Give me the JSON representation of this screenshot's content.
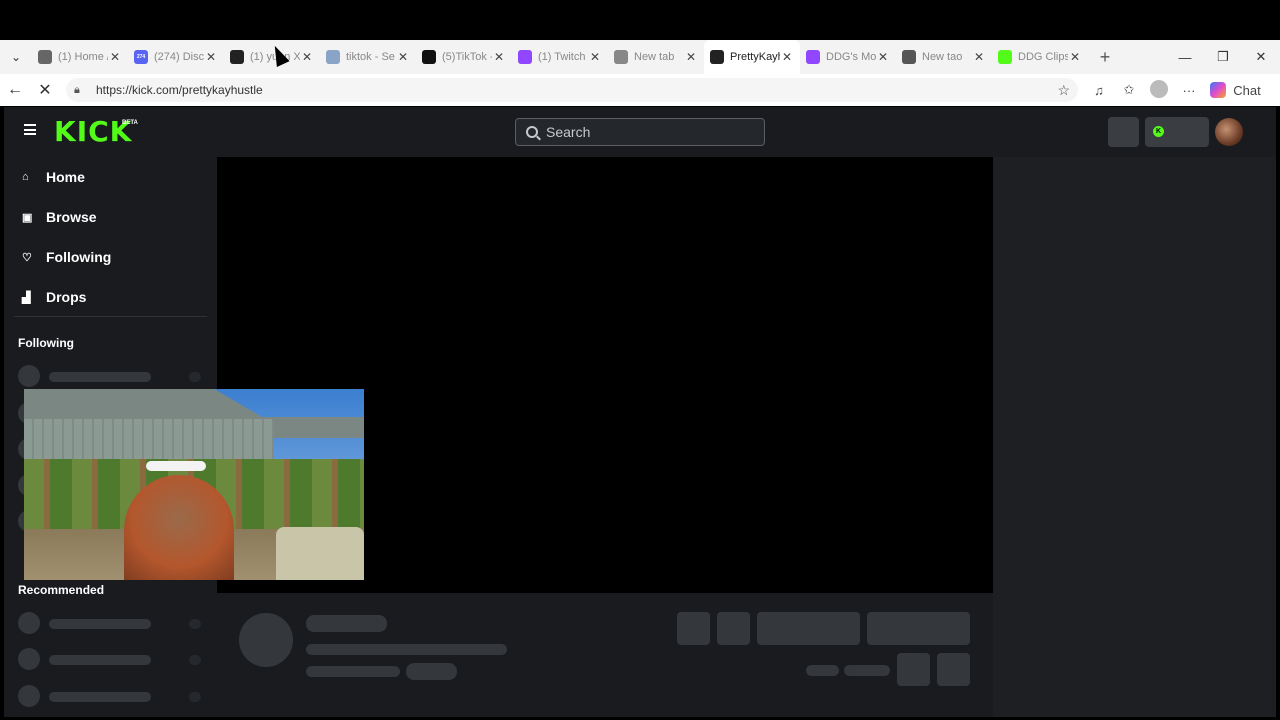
{
  "browser": {
    "tabs": [
      {
        "title": "(1) Home /",
        "icon": "x-logo-icon",
        "color": "#666666",
        "active": false
      },
      {
        "title": "(274) Disco",
        "icon": "discord-icon",
        "color": "#5865f2",
        "badge": "274",
        "active": false
      },
      {
        "title": "(1) yuon X",
        "icon": "x-logo-icon",
        "color": "#222222",
        "active": false
      },
      {
        "title": "tiktok - Se",
        "icon": "search-icon",
        "color": "#8aa4c8",
        "active": false
      },
      {
        "title": "(5)TikTok -",
        "icon": "tiktok-icon",
        "color": "#111111",
        "active": false
      },
      {
        "title": "(1) Twitch",
        "icon": "twitch-icon",
        "color": "#9146ff",
        "active": false
      },
      {
        "title": "New tab",
        "icon": "newtab-icon",
        "color": "#888888",
        "active": false
      },
      {
        "title": "PrettyKayh",
        "icon": "loading-icon",
        "color": "#222222",
        "active": true
      },
      {
        "title": "DDG's Moc",
        "icon": "twitch-icon",
        "color": "#9146ff",
        "active": false
      },
      {
        "title": "New tao",
        "icon": "newtab-icon",
        "color": "#555555",
        "active": false
      },
      {
        "title": "DDG Clips",
        "icon": "kick-icon",
        "color": "#53fc18",
        "active": false
      }
    ],
    "url": "https://kick.com/prettykayhustle",
    "chat_label": "Chat"
  },
  "kick": {
    "logo": "KICK",
    "beta": "BETA",
    "search_placeholder": "Search",
    "nav": [
      {
        "label": "Home",
        "icon": "home-icon",
        "glyph": "⌂"
      },
      {
        "label": "Browse",
        "icon": "browse-icon",
        "glyph": "▣"
      },
      {
        "label": "Following",
        "icon": "heart-icon",
        "glyph": "♡"
      },
      {
        "label": "Drops",
        "icon": "drops-icon",
        "glyph": "▟"
      }
    ],
    "following_heading": "Following",
    "recommended_heading": "Recommended",
    "brand_color": "#53fc18"
  }
}
